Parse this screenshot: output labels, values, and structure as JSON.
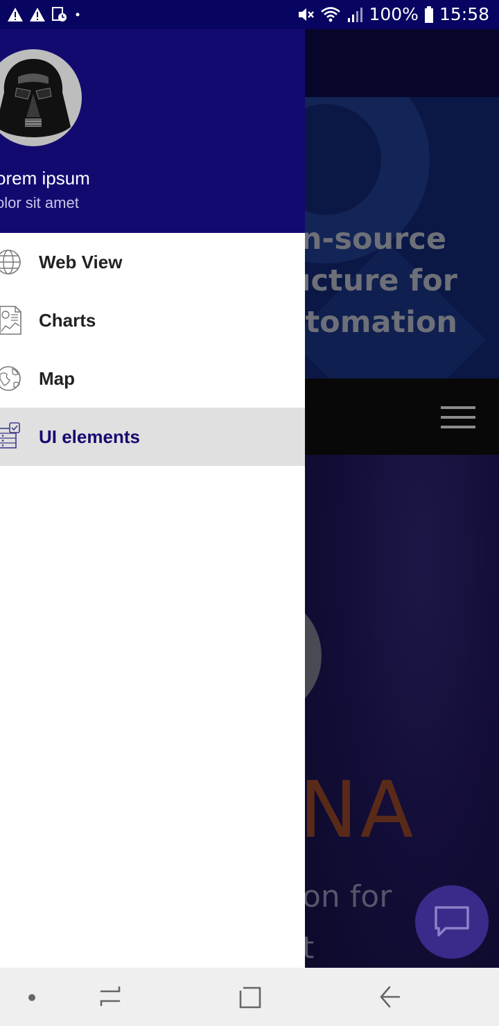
{
  "status_bar": {
    "battery_percent": "100%",
    "time": "15:58",
    "icons": [
      "warning-icon",
      "warning-icon",
      "calendar-clock-icon",
      "dot-icon",
      "mute-icon",
      "wifi-icon",
      "signal-icon",
      "battery-icon"
    ]
  },
  "drawer": {
    "header": {
      "name": "orem ipsum",
      "subtitle": "olor sit amet",
      "avatar_icon": "darth-vader-avatar"
    },
    "items": [
      {
        "label": "Web View",
        "icon": "globe-icon",
        "active": false
      },
      {
        "label": "Charts",
        "icon": "chart-document-icon",
        "active": false
      },
      {
        "label": "Map",
        "icon": "earth-icon",
        "active": false
      },
      {
        "label": "UI elements",
        "icon": "ui-elements-icon",
        "active": true
      }
    ],
    "colors": {
      "header_bg": "#130a70",
      "active_bg": "#e0e0e0",
      "active_text": "#160a70"
    }
  },
  "background_page": {
    "hero_lines": [
      "n-source",
      "ucture for",
      "tomation"
    ],
    "big_text": "NA",
    "sub_lines": [
      "on for",
      "t"
    ]
  },
  "nav_bar": {
    "buttons": [
      "dot-icon",
      "recent-apps-icon",
      "home-icon",
      "back-icon"
    ]
  }
}
